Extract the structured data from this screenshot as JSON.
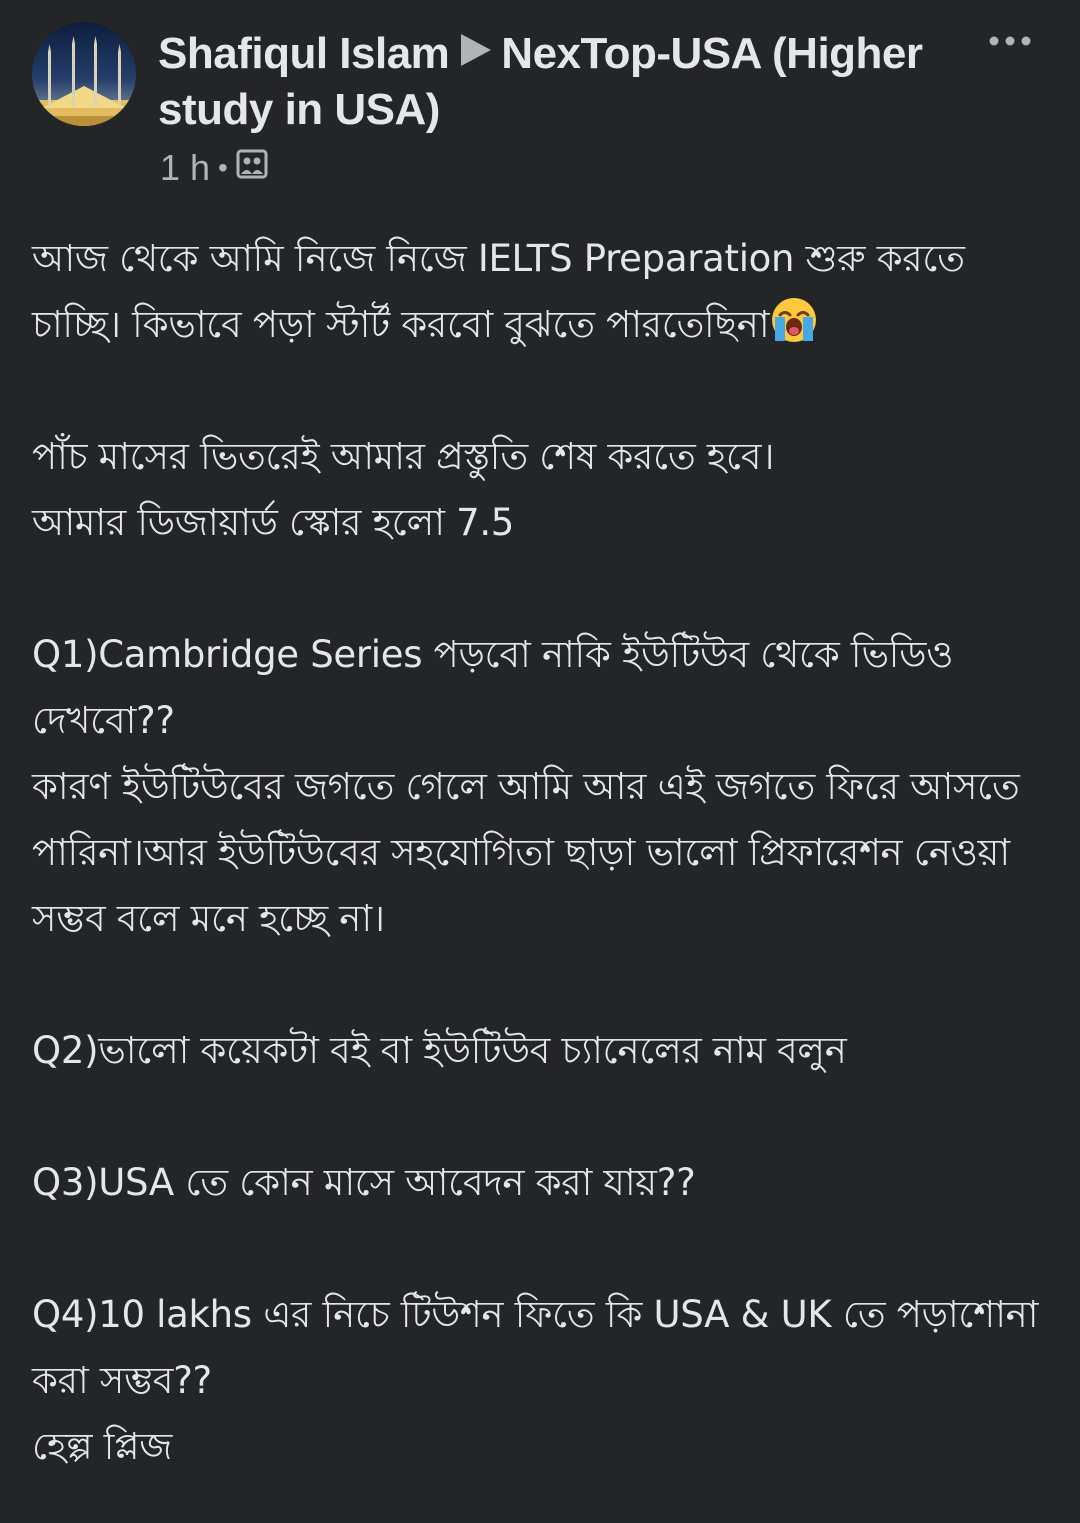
{
  "post": {
    "author": "Shafiqul Islam",
    "group": "NexTop-USA (Higher study in USA)",
    "time": "1 h",
    "audience_icon": "group-audience-icon",
    "more_icon": "more-options-icon",
    "body": {
      "p1": "আজ থেকে আমি নিজে নিজে IELTS Preparation  শুরু করতে চাচ্ছি। কিভাবে পড়া স্টার্ট করবো বুঝতে পারতেছিনা",
      "p1_emoji": "loudly-crying-face-emoji",
      "p2_line1": "পাঁচ মাসের ভিতরেই আমার প্রস্তুতি শেষ করতে হবে।",
      "p2_line2": "আমার ডিজায়ার্ড স্কোর হলো  7.5",
      "q1": "Q1)Cambridge Series পড়বো নাকি ইউটিউব থেকে ভিডিও দেখবো??",
      "q1_reason": "কারণ ইউটিউবের জগতে গেলে আমি আর এই জগতে ফিরে আসতে পারিনা।আর ইউটিউবের সহযোগিতা ছাড়া ভালো প্রিফারেশন  নেওয়া সম্ভব বলে মনে হচ্ছে না।",
      "q2": "Q2)ভালো কয়েকটা বই বা ইউটিউব চ্যানেলের নাম বলুন",
      "q3": "Q3)USA তে কোন মাসে আবেদন করা যায়??",
      "q4": "Q4)10 lakhs  এর নিচে টিউশন ফিতে কি USA & UK তে পড়াশোনা করা সম্ভব??",
      "closing": "হেল্প প্লিজ"
    }
  },
  "colors": {
    "background": "#242526",
    "primary_text": "#e4e6eb",
    "secondary_text": "#b0b3b8"
  }
}
